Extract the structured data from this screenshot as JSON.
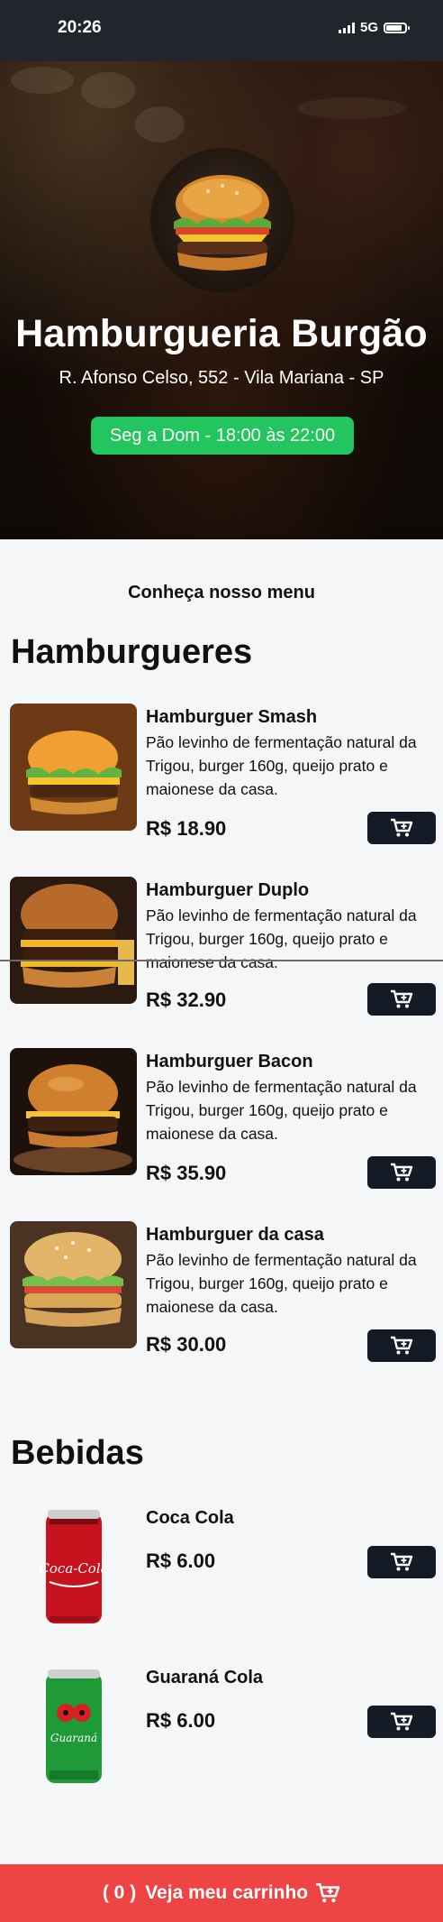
{
  "status": {
    "time": "20:26",
    "network": "5G"
  },
  "hero": {
    "title": "Hamburgueria Burgão",
    "address": "R. Afonso Celso, 552 - Vila Mariana - SP",
    "hours": "Seg a Dom - 18:00 às 22:00"
  },
  "menu": {
    "intro": "Conheça nosso menu",
    "burgers_title": "Hamburgueres",
    "drinks_title": "Bebidas",
    "burgers": [
      {
        "name": "Hamburguer Smash",
        "desc": "Pão levinho de fermentação natural da Trigou, burger 160g, queijo prato e maionese da casa.",
        "price": "R$ 18.90"
      },
      {
        "name": "Hamburguer Duplo",
        "desc": "Pão levinho de fermentação natural da Trigou, burger 160g, queijo prato e maionese da casa.",
        "price": "R$ 32.90"
      },
      {
        "name": "Hamburguer Bacon",
        "desc": "Pão levinho de fermentação natural da Trigou, burger 160g, queijo prato e maionese da casa.",
        "price": "R$ 35.90"
      },
      {
        "name": "Hamburguer da casa",
        "desc": "Pão levinho de fermentação natural da Trigou, burger 160g, queijo prato e maionese da casa.",
        "price": "R$ 30.00"
      }
    ],
    "drinks": [
      {
        "name": "Coca Cola",
        "price": "R$ 6.00",
        "can_text": "Coca-Cola"
      },
      {
        "name": "Guaraná Cola",
        "price": "R$ 6.00",
        "can_text": "Guaraná"
      }
    ]
  },
  "cart": {
    "count": "( 0 )",
    "label": "Veja meu carrinho"
  },
  "colors": {
    "accent_green": "#22c55e",
    "button_dark": "#141a26",
    "footer_red": "#ef4444"
  }
}
